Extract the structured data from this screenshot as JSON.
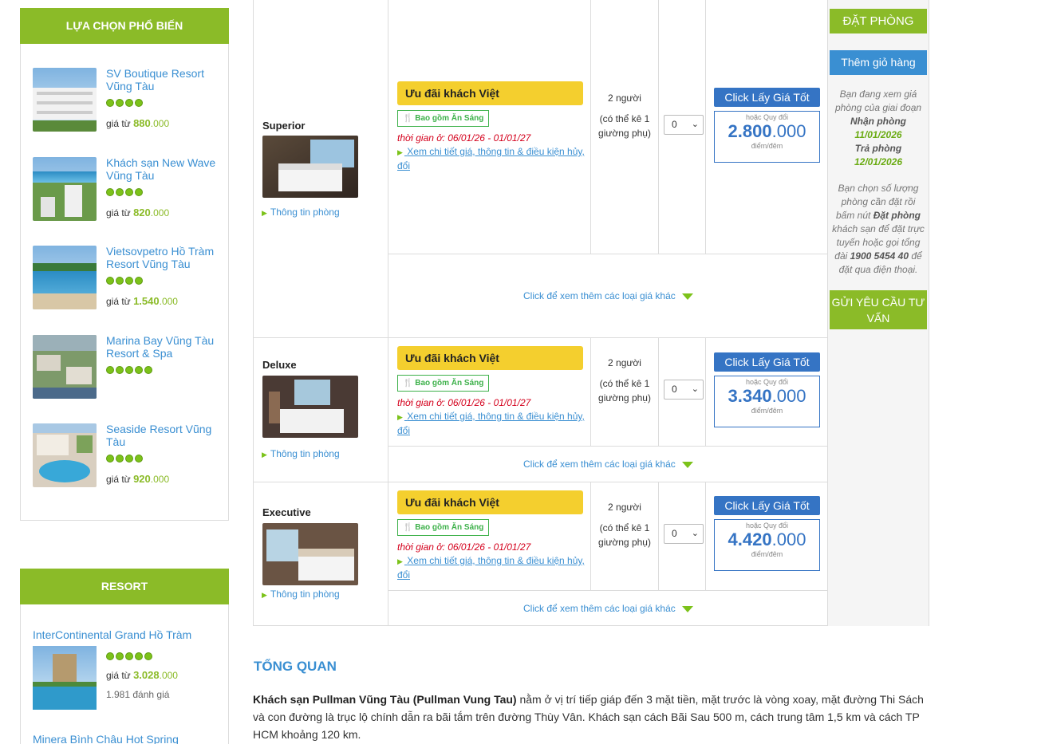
{
  "sidebar": {
    "popular_title": "LỰA CHỌN PHỔ BIẾN",
    "hotels": [
      {
        "name": "SV Boutique Resort Vũng Tàu",
        "stars": 4,
        "price_prefix": "giá từ",
        "price_big": "880",
        "price_small": ".000"
      },
      {
        "name": "Khách sạn New Wave Vũng Tàu",
        "stars": 4,
        "price_prefix": "giá từ",
        "price_big": "820",
        "price_small": ".000"
      },
      {
        "name": "Vietsovpetro Hồ Tràm Resort Vũng Tàu",
        "stars": 4,
        "price_prefix": "giá từ",
        "price_big": "1.540",
        "price_small": ".000"
      },
      {
        "name": "Marina Bay Vũng Tàu Resort & Spa",
        "stars": 5,
        "price_prefix": "",
        "price_big": "",
        "price_small": ""
      },
      {
        "name": "Seaside Resort Vũng Tàu",
        "stars": 4,
        "price_prefix": "giá từ",
        "price_big": "920",
        "price_small": ".000"
      }
    ],
    "resort_title": "RESORT",
    "resort": {
      "name": "InterContinental Grand Hồ Tràm",
      "stars": 5,
      "price_prefix": "giá từ",
      "price_big": "3.028",
      "price_small": ".000",
      "reviews": "1.981 đánh giá"
    },
    "resort_next": "Minera Bình Châu Hot Spring"
  },
  "rooms": [
    {
      "name": "Superior",
      "info": "Thông tin phòng",
      "offer": "Ưu đãi khách Việt",
      "breakfast": "Bao gồm Ăn Sáng",
      "dates": "thời gian ở: 06/01/26 - 01/01/27",
      "detail": "Xem chi tiết giá, thông tin & điều kiện hủy, đổi",
      "capacity": "2 người",
      "extra": "(có thể kê 1 giường phụ)",
      "qty": "0",
      "price_btn": "Click Lấy Giá Tốt",
      "points_label": "hoặc Quy đổi",
      "points_big": "2.800",
      "points_small": ".000",
      "points_unit": "điểm/đêm",
      "more": "Click để xem thêm các loại giá khác"
    },
    {
      "name": "Deluxe",
      "info": "Thông tin phòng",
      "offer": "Ưu đãi khách Việt",
      "breakfast": "Bao gồm Ăn Sáng",
      "dates": "thời gian ở: 06/01/26 - 01/01/27",
      "detail": "Xem chi tiết giá, thông tin & điều kiện hủy, đổi",
      "capacity": "2 người",
      "extra": "(có thể kê 1 giường phụ)",
      "qty": "0",
      "price_btn": "Click Lấy Giá Tốt",
      "points_label": "hoặc Quy đổi",
      "points_big": "3.340",
      "points_small": ".000",
      "points_unit": "điểm/đêm",
      "more": "Click để xem thêm các loại giá khác"
    },
    {
      "name": "Executive",
      "info": "Thông tin phòng",
      "offer": "Ưu đãi khách Việt",
      "breakfast": "Bao gồm Ăn Sáng",
      "dates": "thời gian ở: 06/01/26 - 01/01/27",
      "detail": "Xem chi tiết giá, thông tin & điều kiện hủy, đổi",
      "capacity": "2 người",
      "extra": "(có thể kê 1 giường phụ)",
      "qty": "0",
      "price_btn": "Click Lấy Giá Tốt",
      "points_label": "hoặc Quy đổi",
      "points_big": "4.420",
      "points_small": ".000",
      "points_unit": "điểm/đêm",
      "more": "Click để xem thêm các loại giá khác"
    }
  ],
  "booking": {
    "book_label": "ĐẶT PHÒNG",
    "cart_label": "Thêm giỏ hàng",
    "viewing": "Bạn đang xem giá phòng của giai đoạn",
    "checkin_label": "Nhận phòng",
    "checkin_date": "11/01/2026",
    "checkout_label": "Trả phòng",
    "checkout_date": "12/01/2026",
    "instr_1": "Bạn chọn số lượng phòng cần đặt rồi bấm nút",
    "instr_btn": "Đặt phòng",
    "instr_2": "khách sạn để đặt trực tuyến hoặc gọi tổng đài",
    "hotline": "1900 5454 40",
    "instr_3": "để đặt qua điện thoại.",
    "advise_label": "GỬI YÊU CẦU TƯ VẤN"
  },
  "overview": {
    "title": "TỔNG QUAN",
    "hotel_bold": "Khách sạn Pullman Vũng Tàu (Pullman Vung Tau)",
    "text": " nằm ở vị trí tiếp giáp đến 3 mặt tiền, mặt trước là vòng xoay, mặt đường Thi Sách và con đường là trục lộ chính dẫn ra bãi tắm trên đường Thùy Vân. Khách sạn cách Bãi Sau 500 m, cách trung tâm 1,5 km và cách TP HCM khoảng 120 km."
  },
  "colors": {
    "green": "#8bbb28",
    "blue": "#3574c4",
    "link": "#3a8fd2",
    "offer": "#f4cf2e",
    "date_red": "#d4001c"
  }
}
